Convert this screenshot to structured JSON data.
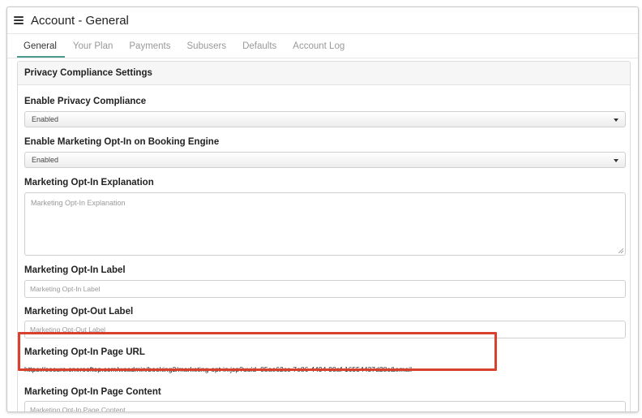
{
  "header": {
    "title": "Account - General"
  },
  "tabs": [
    {
      "label": "General",
      "active": true
    },
    {
      "label": "Your Plan",
      "active": false
    },
    {
      "label": "Payments",
      "active": false
    },
    {
      "label": "Subusers",
      "active": false
    },
    {
      "label": "Defaults",
      "active": false
    },
    {
      "label": "Account Log",
      "active": false
    }
  ],
  "panel": {
    "title": "Privacy Compliance Settings",
    "privacy_compliance": {
      "label": "Enable Privacy Compliance",
      "value": "Enabled"
    },
    "marketing_opt_in_booking": {
      "label": "Enable Marketing Opt-In on Booking Engine",
      "value": "Enabled"
    },
    "opt_in_explanation": {
      "label": "Marketing Opt-In Explanation",
      "placeholder": "Marketing Opt-In Explanation"
    },
    "opt_in_label": {
      "label": "Marketing Opt-In Label",
      "placeholder": "Marketing Opt-In Label"
    },
    "opt_out_label": {
      "label": "Marketing Opt-Out Label",
      "placeholder": "Marketing Opt-Out Label"
    },
    "opt_in_page_url": {
      "label": "Marketing Opt-In Page URL",
      "value": "https://secure.onerooftop.com/wcadmin/booking2/marketing-opt-in.jsp?uuid=85ae62cc-7e86-4494-98af-16554437d28c&email="
    },
    "opt_in_page_content": {
      "label": "Marketing Opt-In Page Content",
      "placeholder": "Marketing Opt-In Page Content"
    }
  },
  "colors": {
    "highlight": "#d9412e",
    "active_tab_underline": "#4a9a8f"
  },
  "icons": {
    "menu": "hamburger-icon",
    "dropdown": "caret-down-icon",
    "resize": "resize-grip-icon"
  }
}
